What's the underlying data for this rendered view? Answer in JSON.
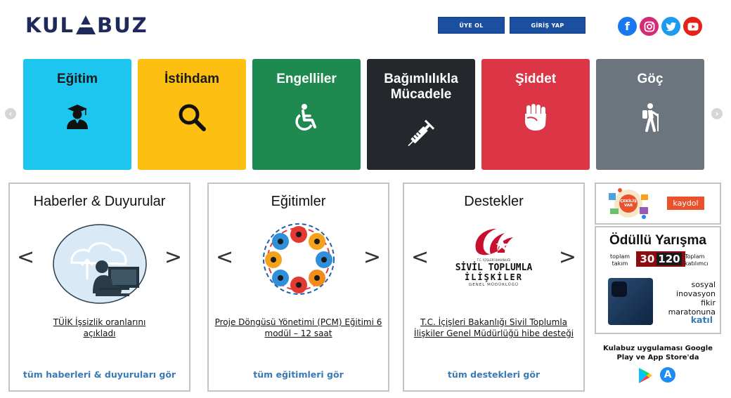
{
  "header": {
    "logo_left": "KUL",
    "logo_right": "BUZ",
    "register_label": "ÜYE OL",
    "login_label": "GİRİŞ YAP",
    "social_icons": [
      "facebook-icon",
      "instagram-icon",
      "twitter-icon",
      "youtube-icon"
    ]
  },
  "categories": [
    {
      "label": "Eğitim",
      "color": "#1cc6ef",
      "icon": "graduate-icon"
    },
    {
      "label": "İstihdam",
      "color": "#fdbf12",
      "icon": "search-icon"
    },
    {
      "label": "Engelliler",
      "color": "#1f8a4f",
      "icon": "wheelchair-icon"
    },
    {
      "label": "Bağımlılıkla Mücadele",
      "color": "#24272b",
      "icon": "syringe-icon"
    },
    {
      "label": "Şiddet",
      "color": "#dc3545",
      "icon": "fist-icon"
    },
    {
      "label": "Göç",
      "color": "#6c757d",
      "icon": "hiker-icon"
    }
  ],
  "cards": [
    {
      "title": "Haberler & Duyurular",
      "link": "TÜİK İşsizlik oranlarını açıkladı",
      "more": "tüm haberleri & duyuruları gör"
    },
    {
      "title": "Eğitimler",
      "link": "Proje Döngüsü Yönetimi (PCM) Eğitimi 6 modül – 12 saat",
      "more": "tüm eğitimleri gör"
    },
    {
      "title": "Destekler",
      "link": "T.C. İçişleri Bakanlığı Sivil Toplumla İlişkiler Genel Müdürlüğü hibe desteği",
      "more": "tüm destekleri gör"
    }
  ],
  "stk_logo": {
    "small": "T.C. İÇİŞLERİ BAKANLIĞI",
    "line1": "SİVİL TOPLUMLA",
    "line2": "İLİŞKİLER",
    "line3": "GENEL MÜDÜRLÜĞÜ"
  },
  "raffle": {
    "badge": "ÇEKİLİŞ VAR",
    "button": "kaydol"
  },
  "prize": {
    "title": "Ödüllü Yarışma",
    "team_label": "toplam takım",
    "team_count": "30",
    "participant_count": "120",
    "participant_label": "Toplam katılımcı",
    "description": "sosyal inovasyon fikir maratonuna",
    "join": "katıl"
  },
  "app": {
    "note": "Kulabuz uygulaması Google Play ve App Store'da"
  },
  "colors": {
    "brand_navy": "#1f2a5c",
    "button_blue": "#1b4fa0",
    "link_blue": "#3a7ab5"
  }
}
